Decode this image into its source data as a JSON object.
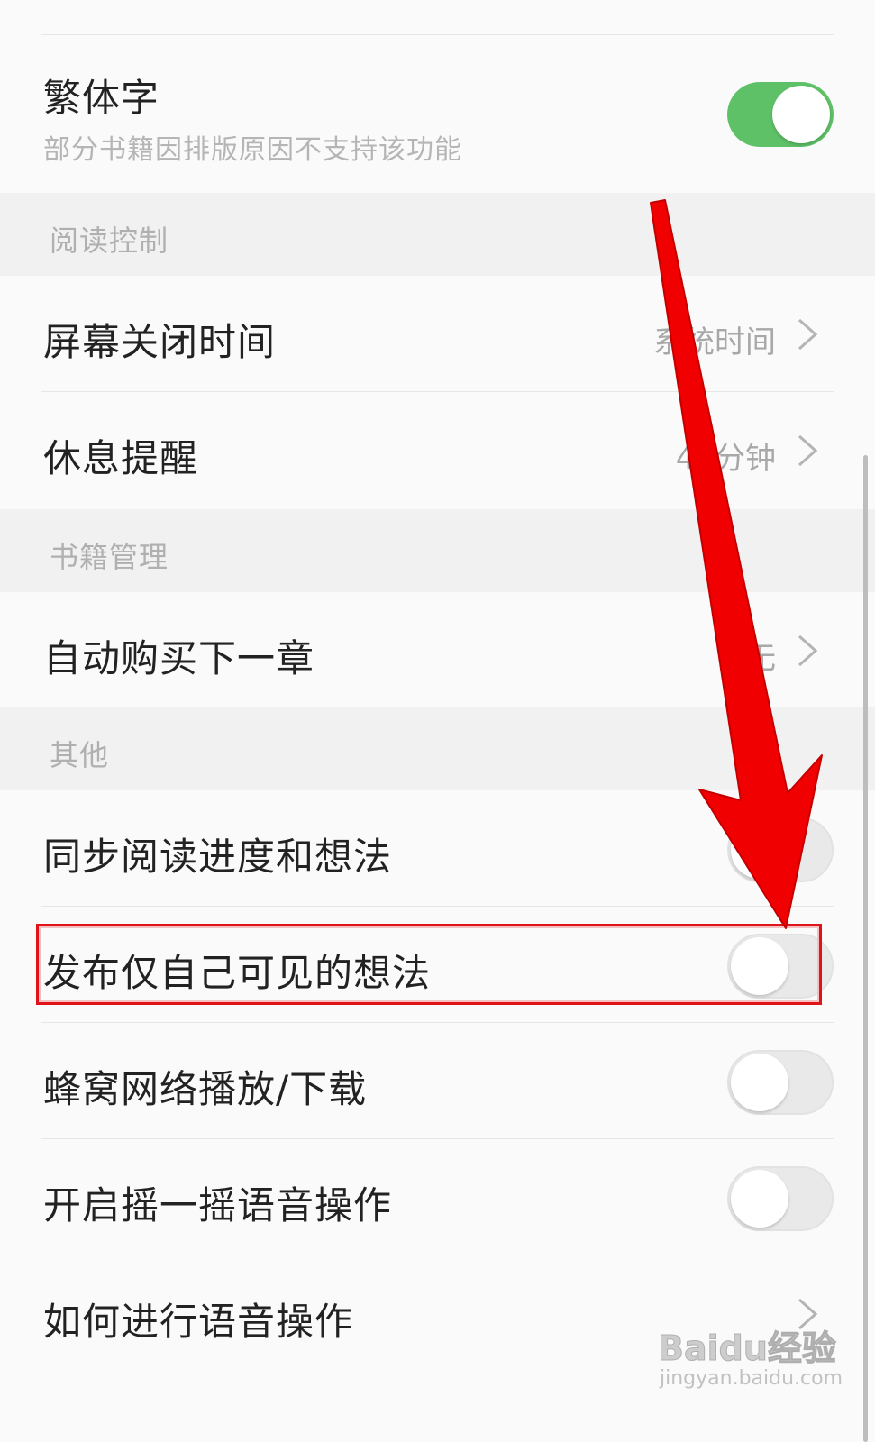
{
  "settings": {
    "traditional": {
      "title": "繁体字",
      "subtitle": "部分书籍因排版原因不支持该功能",
      "toggle_on": true
    },
    "section_reading": "阅读控制",
    "screen_off": {
      "title": "屏幕关闭时间",
      "value": "系统时间"
    },
    "rest_reminder": {
      "title": "休息提醒",
      "value": "45分钟"
    },
    "section_books": "书籍管理",
    "auto_buy": {
      "title": "自动购买下一章",
      "value": "无"
    },
    "section_other": "其他",
    "sync_progress": {
      "title": "同步阅读进度和想法",
      "toggle_on": false
    },
    "private_thoughts": {
      "title": "发布仅自己可见的想法",
      "toggle_on": false
    },
    "cellular": {
      "title": "蜂窝网络播放/下载",
      "toggle_on": false
    },
    "shake_voice": {
      "title": "开启摇一摇语音操作",
      "toggle_on": false
    },
    "how_voice": {
      "title": "如何进行语音操作"
    }
  },
  "colors": {
    "toggle_on": "#5fc167",
    "toggle_off": "#e9e9e9",
    "annotation_red": "#e0131a",
    "section_bg": "#f1f1f1",
    "row_bg": "#fafafa"
  },
  "annotation": {
    "arrow_icon": "red-arrow-icon",
    "highlight": "private_thoughts"
  },
  "watermark": {
    "brand": "Baidu经验",
    "url": "jingyan.baidu.com"
  }
}
